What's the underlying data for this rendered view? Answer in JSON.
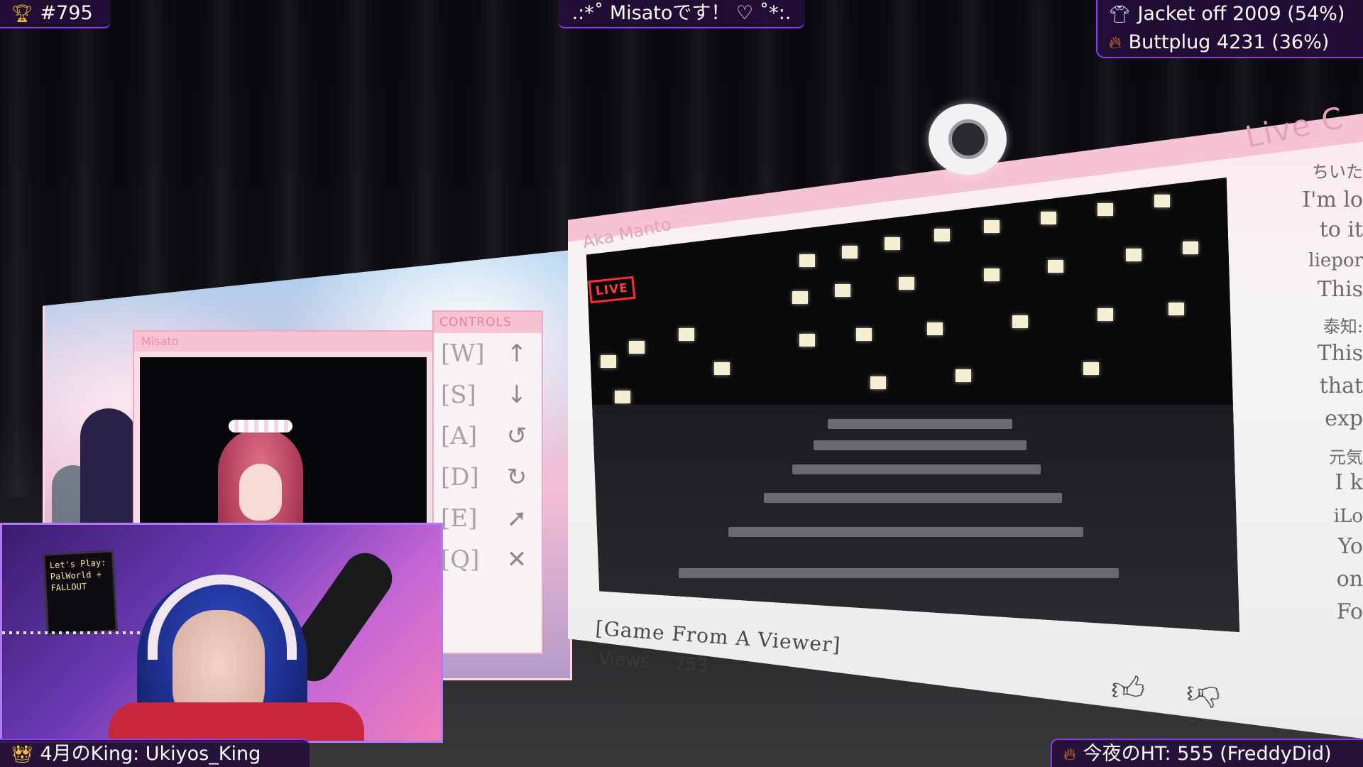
{
  "overlay": {
    "rank": {
      "icon": "trophy-icon",
      "text": "#795"
    },
    "center_title": ".:*˚ Misatoです！ ♡ ˚*:.",
    "goals": [
      {
        "icon": "jacket-icon",
        "text": "Jacket off  2009 (54%)",
        "progress": 0.54
      },
      {
        "icon": "fire-icon",
        "text": "Buttplug 4231 (36%)",
        "progress": 0.36
      }
    ],
    "king": {
      "icon": "crown-icon",
      "text": "4月のKing:  Ukiyos_King"
    },
    "high_tip": {
      "icon": "fire-icon",
      "text": "今夜のHT:  555 (FreddyDid)"
    }
  },
  "left_monitor": {
    "window_title": "Misato",
    "controls_title": "CONTROLS",
    "controls": [
      {
        "key": "[W]",
        "icon": "arrow-up-icon",
        "glyph": "↑"
      },
      {
        "key": "[S]",
        "icon": "arrow-down-icon",
        "glyph": "↓"
      },
      {
        "key": "[A]",
        "icon": "rotate-left-icon",
        "glyph": "↺"
      },
      {
        "key": "[D]",
        "icon": "rotate-right-icon",
        "glyph": "↻"
      },
      {
        "key": "[E]",
        "icon": "cursor-icon",
        "glyph": "➚"
      },
      {
        "key": "[Q]",
        "icon": "close-icon",
        "glyph": "✕"
      }
    ]
  },
  "webcam": {
    "board_text": "Let's Play: PalWorld + FALLOUT"
  },
  "game_window": {
    "title": "Aka Manto",
    "live_label": "LIVE",
    "caption": "[Game From A Viewer]",
    "views_label": "Views:",
    "views_count": "753",
    "chat_title": "Live C",
    "chat_lines": [
      "ちいた",
      "I'm lo",
      "to it",
      "liepor",
      "This",
      "泰知:",
      "This",
      "that",
      "exp",
      "元気",
      "I k",
      "iLo",
      "Yo",
      "on",
      "Fo"
    ]
  },
  "colors": {
    "overlay_bg": "#240e3a",
    "overlay_accent": "#8a3cf0",
    "pink_frame": "#f6c3d5",
    "live_red": "#ff2d2d"
  }
}
